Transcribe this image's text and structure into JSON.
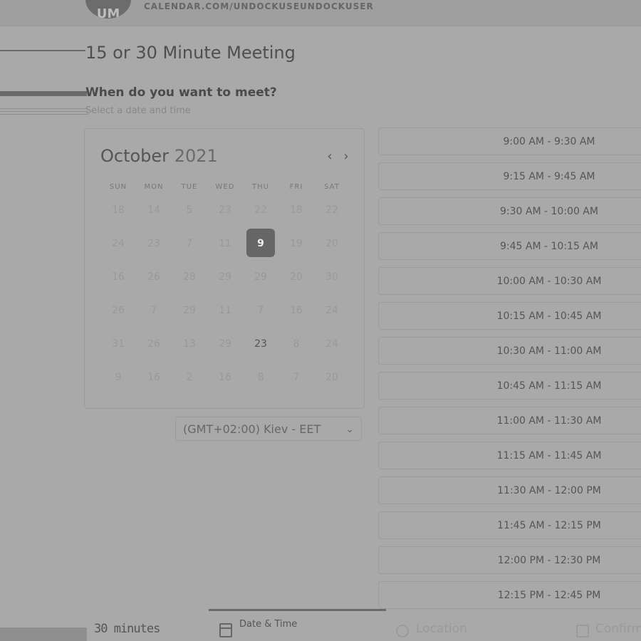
{
  "header": {
    "avatar_initials": "UM",
    "url": "CALENDAR.COM/UNDOCKUSEUNDOCKUSER"
  },
  "page": {
    "title": "15 or 30 Minute Meeting",
    "question": "When do you want to meet?",
    "hint": "Select a date and time"
  },
  "calendar": {
    "month": "October",
    "year": "2021",
    "prev_icon": "chevron-left-icon",
    "next_icon": "chevron-right-icon",
    "weekdays": [
      "SUN",
      "MON",
      "TUE",
      "WED",
      "THU",
      "FRI",
      "SAT"
    ],
    "rows": [
      [
        "18",
        "14",
        "5",
        "23",
        "22",
        "18",
        "22"
      ],
      [
        "24",
        "23",
        "7",
        "11",
        "9",
        "19",
        "20"
      ],
      [
        "16",
        "26",
        "28",
        "29",
        "29",
        "20",
        "30"
      ],
      [
        "26",
        "7",
        "29",
        "11",
        "7",
        "16",
        "24"
      ],
      [
        "31",
        "26",
        "13",
        "29",
        "23",
        "8",
        "24"
      ],
      [
        "9",
        "16",
        "2",
        "16",
        "8",
        "7",
        "20"
      ]
    ],
    "selected_day": "9",
    "available_days": [
      "23"
    ]
  },
  "timezone": {
    "value": "(GMT+02:00) Kiev - EET",
    "icon": "chevron-down-icon"
  },
  "slots": [
    "9:00 AM - 9:30 AM",
    "9:15 AM - 9:45 AM",
    "9:30 AM - 10:00 AM",
    "9:45 AM - 10:15 AM",
    "10:00 AM - 10:30 AM",
    "10:15 AM - 10:45 AM",
    "10:30 AM - 11:00 AM",
    "10:45 AM - 11:15 AM",
    "11:00 AM - 11:30 AM",
    "11:15 AM - 11:45 AM",
    "11:30 AM - 12:00 PM",
    "11:45 AM - 12:15 PM",
    "12:00 PM - 12:30 PM",
    "12:15 PM - 12:45 PM"
  ],
  "tabs": {
    "duration": "30 minutes",
    "datetime": "Date & Time",
    "location": "Location",
    "confirm": "Confirm in"
  }
}
